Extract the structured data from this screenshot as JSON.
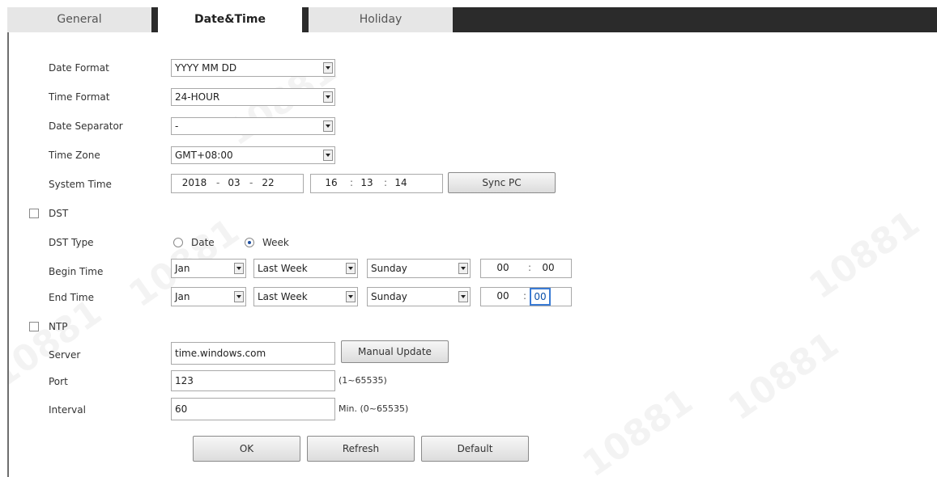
{
  "tabs": [
    {
      "label": "General",
      "active": false
    },
    {
      "label": "Date&Time",
      "active": true
    },
    {
      "label": "Holiday",
      "active": false
    }
  ],
  "form": {
    "date_format": {
      "label": "Date Format",
      "value": "YYYY MM DD"
    },
    "time_format": {
      "label": "Time Format",
      "value": "24-HOUR"
    },
    "date_separator": {
      "label": "Date Separator",
      "value": "-"
    },
    "time_zone": {
      "label": "Time Zone",
      "value": "GMT+08:00"
    },
    "system_time": {
      "label": "System Time",
      "year": "2018",
      "month": "03",
      "day": "22",
      "date_sep": "-",
      "hour": "16",
      "minute": "13",
      "second": "14",
      "time_sep": ":",
      "sync_label": "Sync PC"
    },
    "dst": {
      "label": "DST",
      "checked": false
    },
    "dst_type": {
      "label": "DST Type",
      "options": [
        "Date",
        "Week"
      ],
      "selected": "Week"
    },
    "begin_time": {
      "label": "Begin Time",
      "month": "Jan",
      "week": "Last Week",
      "day": "Sunday",
      "hour": "00",
      "minute": "00",
      "sep": ":"
    },
    "end_time": {
      "label": "End Time",
      "month": "Jan",
      "week": "Last Week",
      "day": "Sunday",
      "hour": "00",
      "minute": "00",
      "sep": ":"
    },
    "ntp": {
      "label": "NTP",
      "checked": false
    },
    "server": {
      "label": "Server",
      "value": "time.windows.com",
      "update_label": "Manual Update"
    },
    "port": {
      "label": "Port",
      "value": "123",
      "hint": "(1~65535)"
    },
    "interval": {
      "label": "Interval",
      "value": "60",
      "hint": "Min. (0~65535)"
    }
  },
  "buttons": {
    "ok": "OK",
    "refresh": "Refresh",
    "default": "Default"
  },
  "watermark": "10881",
  "colors": {
    "tabbar": "#2b2b2b",
    "selection": "#3a7bd5"
  }
}
